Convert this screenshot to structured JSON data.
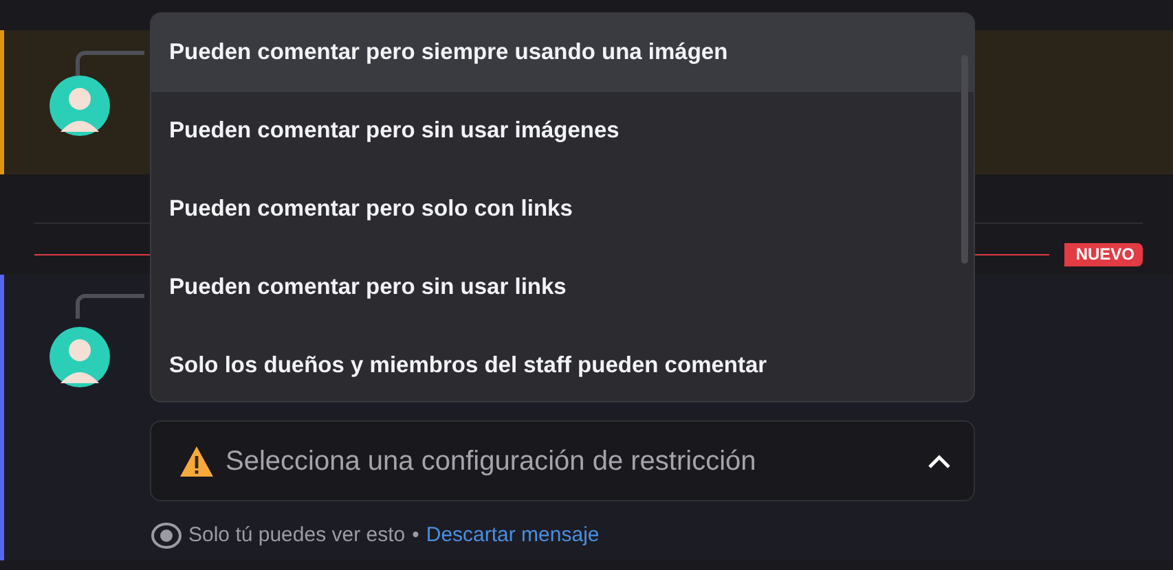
{
  "menu": {
    "items": [
      {
        "label": "Pueden comentar pero siempre usando una imágen",
        "selected": true
      },
      {
        "label": "Pueden comentar pero sin usar imágenes",
        "selected": false
      },
      {
        "label": "Pueden comentar pero solo con links",
        "selected": false
      },
      {
        "label": "Pueden comentar pero sin usar links",
        "selected": false
      },
      {
        "label": "Solo los dueños y miembros del staff pueden comentar",
        "selected": false
      }
    ]
  },
  "new_divider": {
    "badge": "NUEVO"
  },
  "select": {
    "placeholder": "Selecciona una configuración de restricción",
    "expanded": true
  },
  "footer": {
    "note": "Solo tú puedes ver esto",
    "separator": "•",
    "link": "Descartar mensaje"
  }
}
